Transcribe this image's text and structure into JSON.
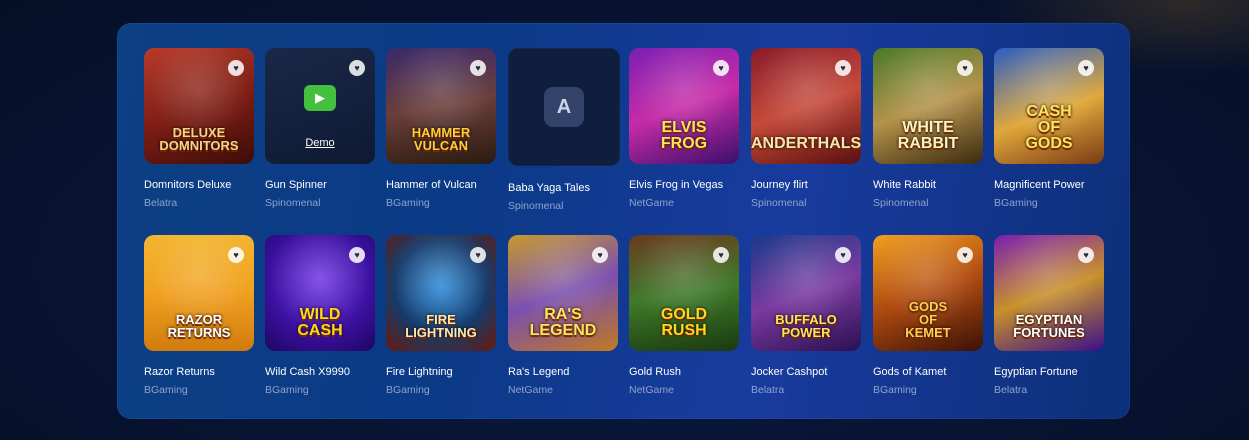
{
  "games": [
    {
      "title": "Domnitors Deluxe",
      "provider": "Belatra",
      "logo": "DELUXE DOMNITORS",
      "bg": "linear-gradient(160deg,#b93a2a 0%,#7a1c14 55%,#3c0d08 100%)",
      "logo_color": "#f6d58a"
    },
    {
      "title": "Gun Spinner",
      "provider": "Spinomenal",
      "demo": "Demo",
      "bg": "linear-gradient(160deg,#1a2848 0%,#0e1a33 100%)"
    },
    {
      "title": "Hammer of Vulcan",
      "provider": "BGaming",
      "logo": "HAMMER VULCAN",
      "bg": "linear-gradient(170deg,#3b2a6a 0%,#6a3e3a 50%,#2a1b10 100%)",
      "logo_color": "#ffcc3a"
    },
    {
      "title": "Baba Yaga Tales",
      "provider": "Spinomenal",
      "placeholder": "A",
      "bg": "#0f1d3e"
    },
    {
      "title": "Elvis Frog in Vegas",
      "provider": "NetGame",
      "logo": "ELVIS FROG",
      "bg": "linear-gradient(160deg,#7a1fb3 0%,#c72ba7 50%,#3a0f6a 100%)",
      "logo_color": "#ffe35c"
    },
    {
      "title": "Journey flirt",
      "provider": "Spinomenal",
      "logo": "ANDERTHALS",
      "bg": "linear-gradient(160deg,#8a1a2a 0%,#c54a3a 50%,#5a1010 100%)",
      "logo_color": "#f5e6b0"
    },
    {
      "title": "White Rabbit",
      "provider": "Spinomenal",
      "logo": "WHITE RABBIT",
      "bg": "linear-gradient(160deg,#4a7a2a 0%,#b4924a 50%,#3a2a10 100%)",
      "logo_color": "#fff2c0"
    },
    {
      "title": "Magnificent Power",
      "provider": "BGaming",
      "logo": "CASH OF GODS",
      "bg": "linear-gradient(160deg,#2a5ec4 0%,#e0a83a 55%,#7a3a14 100%)",
      "logo_color": "#ffe35c"
    },
    {
      "title": "Razor Returns",
      "provider": "BGaming",
      "logo": "RAZOR RETURNS",
      "bg": "linear-gradient(180deg,#f3b530 0%,#f0a020 50%,#d07c0e 100%)",
      "logo_color": "#ffffff"
    },
    {
      "title": "Wild Cash X9990",
      "provider": "BGaming",
      "logo": "WILD CASH",
      "bg": "radial-gradient(circle at 50% 40%,#6b2fe0 0%,#3a0f9c 60%,#1e0660 100%)",
      "logo_color": "#ffd81a"
    },
    {
      "title": "Fire Lightning",
      "provider": "BGaming",
      "logo": "FIRE LIGHTNING",
      "bg": "radial-gradient(circle at 50% 45%,#2a8ad8 0%,#163a6a 55%,#6a1a0a 100%)",
      "logo_color": "#ffe9b0"
    },
    {
      "title": "Ra's Legend",
      "provider": "NetGame",
      "logo": "RA'S LEGEND",
      "bg": "linear-gradient(160deg,#c79a2a 0%,#7a4fb0 50%,#c07a20 100%)",
      "logo_color": "#ffe35c"
    },
    {
      "title": "Gold Rush",
      "provider": "NetGame",
      "logo": "GOLD RUSH",
      "bg": "linear-gradient(170deg,#6a3a20 0%,#3f7a2a 50%,#1a3a10 100%)",
      "logo_color": "#ffd81a"
    },
    {
      "title": "Jocker Cashpot",
      "provider": "Belatra",
      "logo": "BUFFALO POWER",
      "bg": "linear-gradient(160deg,#1a3a8a 0%,#7a3aa0 50%,#2a1050 100%)",
      "logo_color": "#ffe35c"
    },
    {
      "title": "Gods of Kamet",
      "provider": "BGaming",
      "logo": "GODS OF KEMET",
      "bg": "linear-gradient(160deg,#f0a020 0%,#b04a10 50%,#3a1206 100%)",
      "logo_color": "#ffd050"
    },
    {
      "title": "Egyptian Fortune",
      "provider": "Belatra",
      "logo": "EGYPTIAN FORTUNES",
      "bg": "linear-gradient(160deg,#7a1fb3 0%,#c8902a 50%,#3a0f8a 100%)",
      "logo_color": "#ffffff"
    }
  ],
  "heart_glyph": "♥"
}
